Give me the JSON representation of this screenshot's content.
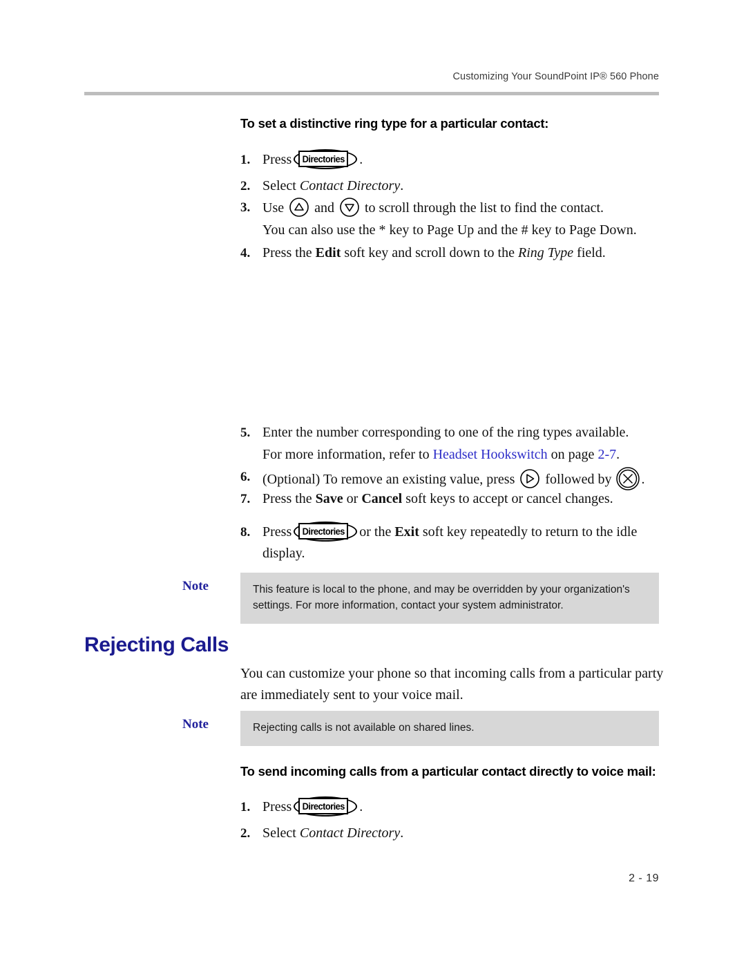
{
  "header": {
    "running_title": "Customizing Your SoundPoint IP® 560 Phone"
  },
  "procedure_1": {
    "heading": "To set a distinctive ring type for a particular contact:",
    "steps": [
      {
        "num": "1.",
        "pre": "Press",
        "key": "Directories",
        "post": "."
      },
      {
        "num": "2.",
        "pre": "Select ",
        "italic": "Contact Directory",
        "post": "."
      },
      {
        "num": "3.",
        "pre": "Use",
        "mid": "and",
        "post": "to scroll through the list to find the contact.",
        "continuation": "You can also use the * key to Page Up and the # key to Page Down."
      },
      {
        "num": "4.",
        "pre": "Press the ",
        "bold": "Edit",
        "mid": " soft key and scroll down to the ",
        "italic": "Ring Type",
        "post": " field."
      },
      {
        "num": "5.",
        "text": "Enter the number corresponding to one of the ring types available.",
        "continuation_pre": "For more information, refer to ",
        "continuation_link": "Headset Hookswitch",
        "continuation_mid": " on page ",
        "continuation_link2": "2-7",
        "continuation_post": "."
      },
      {
        "num": "6.",
        "pre": "(Optional) To remove an existing value, press",
        "mid": "followed by",
        "post": "."
      },
      {
        "num": "7.",
        "pre": "Press the ",
        "bold": "Save",
        "mid": " or ",
        "bold2": "Cancel",
        "post": " soft keys to accept or cancel changes."
      },
      {
        "num": "8.",
        "pre": "Press",
        "key": "Directories",
        "mid": "or the ",
        "bold": "Exit",
        "post": " soft key repeatedly to return to the idle display."
      }
    ]
  },
  "note_1": {
    "label": "Note",
    "text": "This feature is local to the phone, and may be overridden by your organization's settings. For more information, contact your system administrator."
  },
  "section": {
    "title": "Rejecting Calls",
    "body": "You can customize your phone so that incoming calls from a particular party are immediately sent to your voice mail."
  },
  "note_2": {
    "label": "Note",
    "text": "Rejecting calls is not available on shared lines."
  },
  "procedure_2": {
    "heading": "To send incoming calls from a particular contact directly to voice mail:",
    "steps": [
      {
        "num": "1.",
        "pre": "Press",
        "key": "Directories",
        "post": "."
      },
      {
        "num": "2.",
        "pre": "Select ",
        "italic": "Contact Directory",
        "post": "."
      }
    ]
  },
  "footer": {
    "page_number": "2 - 19"
  },
  "colors": {
    "heading_blue": "#1b1b8f",
    "note_label_blue": "#21219c",
    "link_blue": "#2d2dc8",
    "rule_gray": "#bdbdbd",
    "note_bg": "#d7d7d7"
  }
}
